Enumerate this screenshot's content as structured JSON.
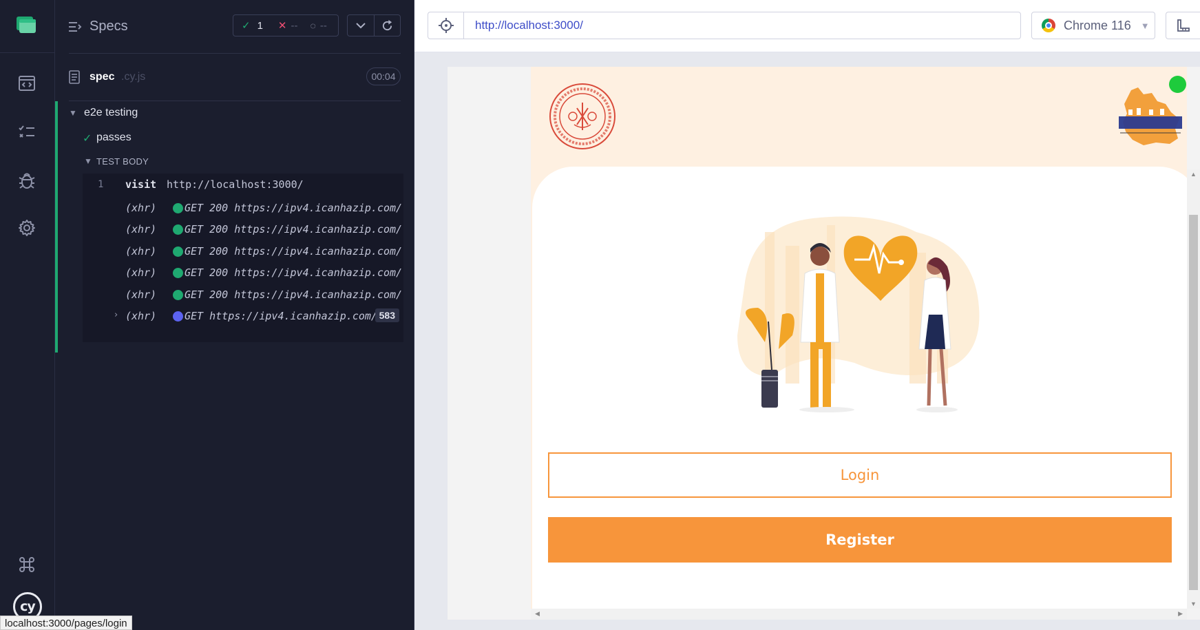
{
  "rail": {
    "items": [
      "specs-nav",
      "runs-nav",
      "debug-nav",
      "settings-nav"
    ],
    "bottom_items": [
      "keyboard-shortcuts",
      "cypress-logo"
    ],
    "logo_text": "cy"
  },
  "reporter": {
    "header_title": "Specs",
    "stats": {
      "passed": "1",
      "failed": "--",
      "pending": "--"
    },
    "spec": {
      "name": "spec",
      "ext": ".cy.js",
      "duration": "00:04"
    },
    "suite": {
      "title": "e2e testing"
    },
    "test": {
      "title": "passes",
      "body_label": "TEST BODY"
    },
    "commands": [
      {
        "num": "1",
        "name": "visit",
        "message": "http://localhost:3000/"
      },
      {
        "tag": "(xhr)",
        "message": "GET 200 https://ipv4.icanhazip.com/",
        "status_color": "#1fa971"
      },
      {
        "tag": "(xhr)",
        "message": "GET 200 https://ipv4.icanhazip.com/",
        "status_color": "#1fa971"
      },
      {
        "tag": "(xhr)",
        "message": "GET 200 https://ipv4.icanhazip.com/",
        "status_color": "#1fa971"
      },
      {
        "tag": "(xhr)",
        "message": "GET 200 https://ipv4.icanhazip.com/",
        "status_color": "#1fa971"
      },
      {
        "tag": "(xhr)",
        "message": "GET 200 https://ipv4.icanhazip.com/",
        "status_color": "#1fa971"
      },
      {
        "tag": "(xhr)",
        "message": "GET https://ipv4.icanhazip.com/",
        "status_color": "#5c63f0",
        "badge": "583"
      }
    ]
  },
  "status_bar_url": "localhost:3000/pages/login",
  "browser": {
    "url": "http://localhost:3000/",
    "browser_name": "Chrome 116"
  },
  "app": {
    "login_label": "Login",
    "register_label": "Register",
    "accent_color": "#f7953b",
    "status_dot_color": "#1ecb3c"
  },
  "colors": {
    "pass": "#1fa971",
    "fail": "#ef4f73",
    "pending_request": "#5c63f0",
    "link": "#3e4dc8",
    "panel_bg": "#1b1e2e"
  }
}
